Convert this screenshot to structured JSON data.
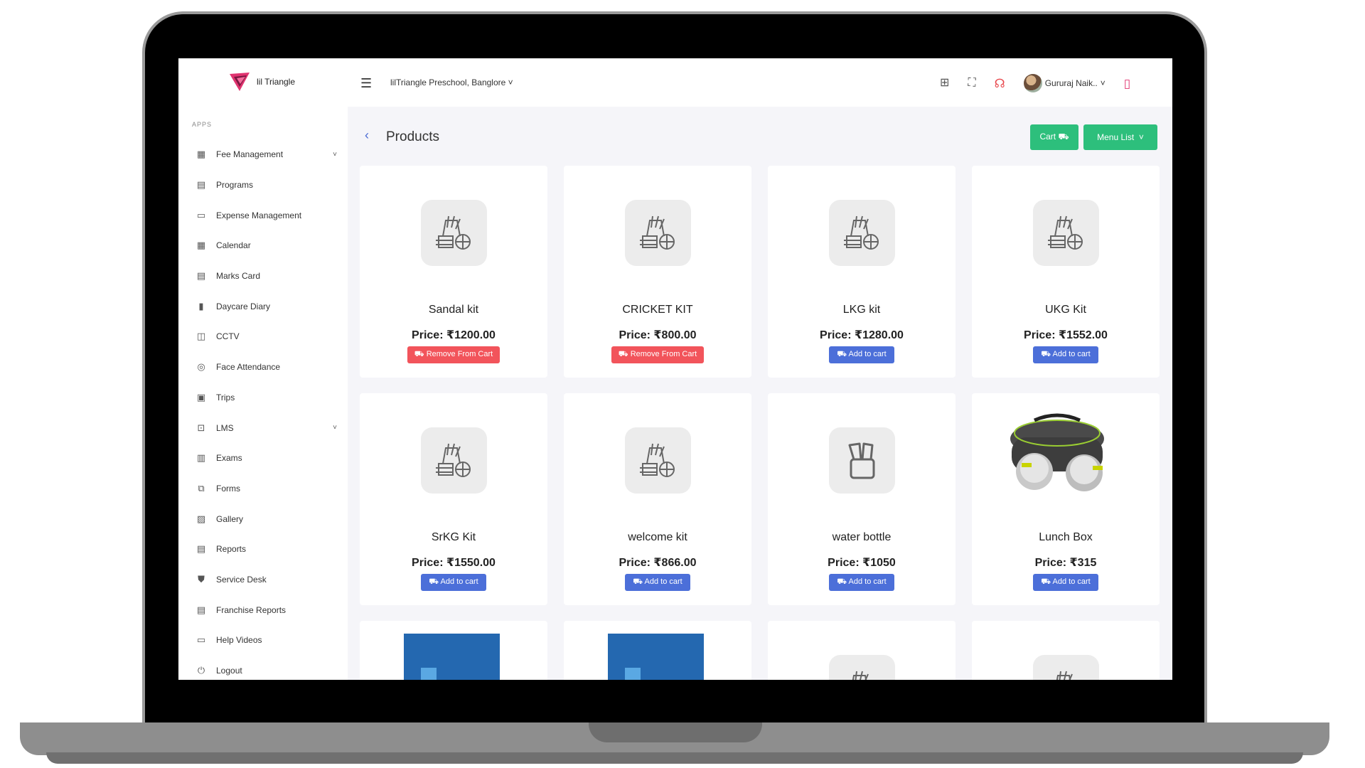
{
  "topbar": {
    "brand": "lil Triangle",
    "school": "lilTriangle Preschool, Banglore",
    "user": "Gururaj Naik.."
  },
  "sidebar": {
    "section": "APPS",
    "items": [
      {
        "label": "Fee Management",
        "icon": "receipt-icon",
        "glyph": "▦",
        "chevron": true
      },
      {
        "label": "Programs",
        "icon": "document-icon",
        "glyph": "▤",
        "chevron": false
      },
      {
        "label": "Expense Management",
        "icon": "credit-card-icon",
        "glyph": "▭",
        "chevron": false
      },
      {
        "label": "Calendar",
        "icon": "calendar-icon",
        "glyph": "▦",
        "chevron": false
      },
      {
        "label": "Marks Card",
        "icon": "marks-card-icon",
        "glyph": "▤",
        "chevron": false
      },
      {
        "label": "Daycare Diary",
        "icon": "diary-icon",
        "glyph": "▮",
        "chevron": false
      },
      {
        "label": "CCTV",
        "icon": "cctv-icon",
        "glyph": "◫",
        "chevron": false
      },
      {
        "label": "Face Attendance",
        "icon": "face-icon",
        "glyph": "◎",
        "chevron": false
      },
      {
        "label": "Trips",
        "icon": "bus-icon",
        "glyph": "▣",
        "chevron": false
      },
      {
        "label": "LMS",
        "icon": "lms-icon",
        "glyph": "⊡",
        "chevron": true
      },
      {
        "label": "Exams",
        "icon": "book-icon",
        "glyph": "▥",
        "chevron": false
      },
      {
        "label": "Forms",
        "icon": "forms-icon",
        "glyph": "⧉",
        "chevron": false
      },
      {
        "label": "Gallery",
        "icon": "gallery-icon",
        "glyph": "▨",
        "chevron": false
      },
      {
        "label": "Reports",
        "icon": "reports-icon",
        "glyph": "▤",
        "chevron": false
      },
      {
        "label": "Service Desk",
        "icon": "shield-icon",
        "glyph": "⛊",
        "chevron": false
      },
      {
        "label": "Franchise Reports",
        "icon": "franchise-reports-icon",
        "glyph": "▤",
        "chevron": false
      },
      {
        "label": "Help Videos",
        "icon": "monitor-icon",
        "glyph": "▭",
        "chevron": false
      },
      {
        "label": "Logout",
        "icon": "power-icon",
        "glyph": "⏻",
        "chevron": false
      }
    ]
  },
  "main": {
    "title": "Products",
    "cart_label": "Cart",
    "menu_label": "Menu List",
    "products": [
      {
        "name": "Sandal kit",
        "price": "Price: ₹1200.00",
        "action": "Remove From Cart",
        "state": "remove",
        "image": "kit"
      },
      {
        "name": "CRICKET KIT",
        "price": "Price: ₹800.00",
        "action": "Remove From Cart",
        "state": "remove",
        "image": "kit"
      },
      {
        "name": "LKG kit",
        "price": "Price: ₹1280.00",
        "action": "Add to cart",
        "state": "add",
        "image": "kit"
      },
      {
        "name": "UKG Kit",
        "price": "Price: ₹1552.00",
        "action": "Add to cart",
        "state": "add",
        "image": "kit"
      },
      {
        "name": "SrKG Kit",
        "price": "Price: ₹1550.00",
        "action": "Add to cart",
        "state": "add",
        "image": "kit"
      },
      {
        "name": "welcome kit",
        "price": "Price: ₹866.00",
        "action": "Add to cart",
        "state": "add",
        "image": "kit"
      },
      {
        "name": "water bottle",
        "price": "Price: ₹1050",
        "action": "Add to cart",
        "state": "add",
        "image": "pencil-cup"
      },
      {
        "name": "Lunch Box",
        "price": "Price: ₹315",
        "action": "Add to cart",
        "state": "add",
        "image": "lunchbox"
      }
    ],
    "partial_row": [
      {
        "image": "blue"
      },
      {
        "image": "blue"
      },
      {
        "image": "kit"
      },
      {
        "image": "kit"
      }
    ]
  },
  "colors": {
    "green": "#2dbf7c",
    "remove": "#f2545b",
    "add": "#4c6fd9"
  }
}
